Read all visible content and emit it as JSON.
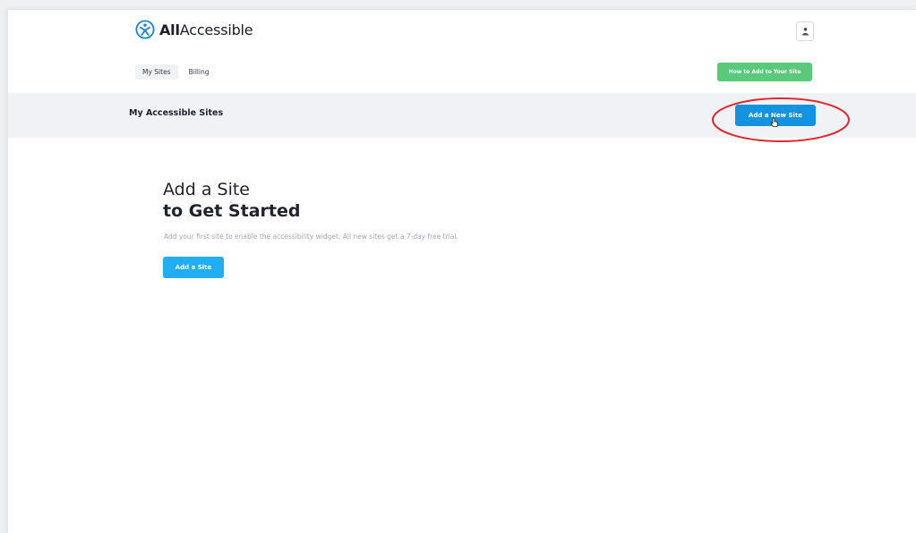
{
  "brand": {
    "name_bold": "All",
    "name_rest": "Accessible",
    "logo_icon": "person-circle-logo-icon"
  },
  "header": {
    "avatar_icon": "user-icon"
  },
  "nav": {
    "tabs": [
      {
        "label": "My Sites",
        "active": true
      },
      {
        "label": "Billing",
        "active": false
      }
    ],
    "how_to_label": "How to Add to Your Site"
  },
  "section": {
    "title": "My Accessible Sites",
    "add_new_label": "Add a New Site"
  },
  "empty_state": {
    "heading_line1": "Add a Site",
    "heading_line2": "to Get Started",
    "description": "Add your first site to enable the accessibility widget. All new sites get a 7-day free trial.",
    "button_label": "Add a Site"
  },
  "colors": {
    "primary": "#1493e0",
    "cta": "#21aef3",
    "success": "#5ac97a",
    "annotation": "#e0282e"
  }
}
